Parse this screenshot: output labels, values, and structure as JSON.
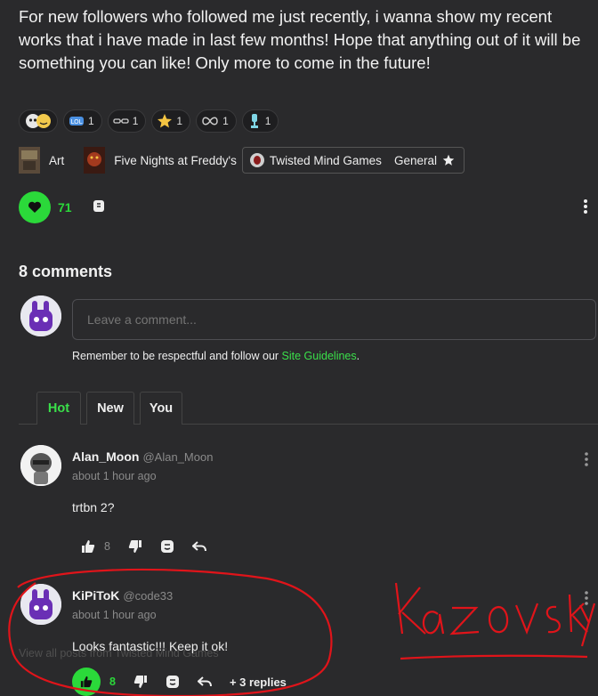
{
  "post": {
    "text": "For new followers who followed me just recently, i wanna show my recent works that i have made in last few months! Hope that anything out of it will be something you can like! Only more to come in the future!"
  },
  "reactions": [
    {
      "icon": "emoji-faces-icon",
      "count": ""
    },
    {
      "icon": "lol-badge-icon",
      "count": "1"
    },
    {
      "icon": "sunglasses-icon",
      "count": "1"
    },
    {
      "icon": "star-icon",
      "count": "1"
    },
    {
      "icon": "infinity-icon",
      "count": "1"
    },
    {
      "icon": "trophy-icon",
      "count": "1"
    }
  ],
  "tags": {
    "art": "Art",
    "fnaf": "Five Nights at Freddy's",
    "game": "Twisted Mind Games",
    "category": "General"
  },
  "likes": {
    "count": "71"
  },
  "comments_section": {
    "title": "8 comments",
    "input_placeholder": "Leave a comment...",
    "guideline_prefix": "Remember to be respectful and follow our ",
    "guideline_link": "Site Guidelines",
    "guideline_suffix": "."
  },
  "tabs": [
    "Hot",
    "New",
    "You"
  ],
  "comments": [
    {
      "name": "Alan_Moon",
      "handle": "@Alan_Moon",
      "time": "about 1 hour ago",
      "body": "trtbn 2?",
      "likes": "8"
    },
    {
      "name": "KiPiToK",
      "handle": "@code33",
      "time": "about 1 hour ago",
      "body": "Looks fantastic!!! Keep it ok!",
      "likes": "8",
      "replies": "+ 3 replies"
    }
  ],
  "footer": {
    "view_all": "View all posts from Twisted Mind Games"
  },
  "annotation": {
    "text": "Kazovsky",
    "color": "#e0141a"
  },
  "colors": {
    "accent": "#2bd93a",
    "background": "#2a2a2c"
  }
}
